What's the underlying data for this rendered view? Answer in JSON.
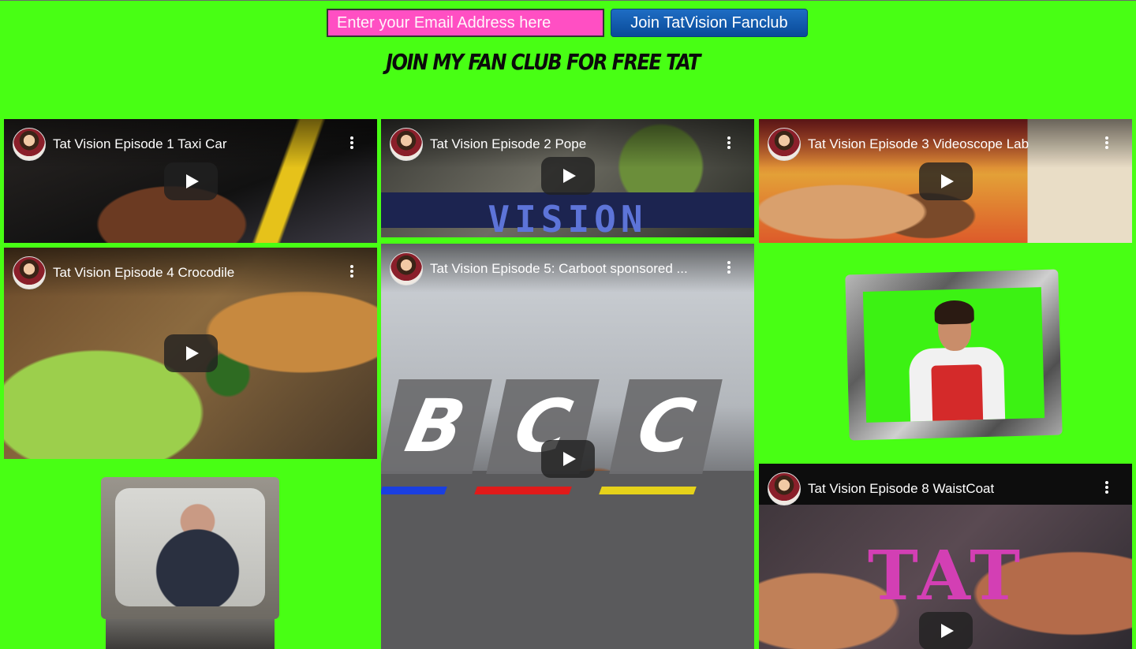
{
  "signup": {
    "email_placeholder": "Enter your Email Address here",
    "join_label": "Join TatVision Fanclub",
    "tagline": "JOIN MY FAN CLUB FOR FREE TAT"
  },
  "videos": [
    {
      "title": "Tat Vision Episode 1 Taxi Car"
    },
    {
      "title": "Tat Vision Episode 2 Pope",
      "overlay_text": "VISION"
    },
    {
      "title": "Tat Vision Episode 3 Videoscope Lab"
    },
    {
      "title": "Tat Vision Episode 4 Crocodile"
    },
    {
      "title": "Tat Vision Episode 5: Carboot sponsored ...",
      "overlay_letters": [
        "B",
        "C",
        "C"
      ]
    },
    {
      "title": "Tat Vision Episode 8 WaistCoat",
      "overlay_text": "TAT"
    }
  ],
  "colors": {
    "page_background": "#48ff14",
    "email_background": "#ff4fc3",
    "button_background": "#1e6dc4",
    "bcc_bars": [
      "#1a3fe0",
      "#e01a1a",
      "#e6d21a"
    ]
  },
  "icons": [
    "channel-avatar",
    "more-options-icon",
    "play-icon"
  ]
}
